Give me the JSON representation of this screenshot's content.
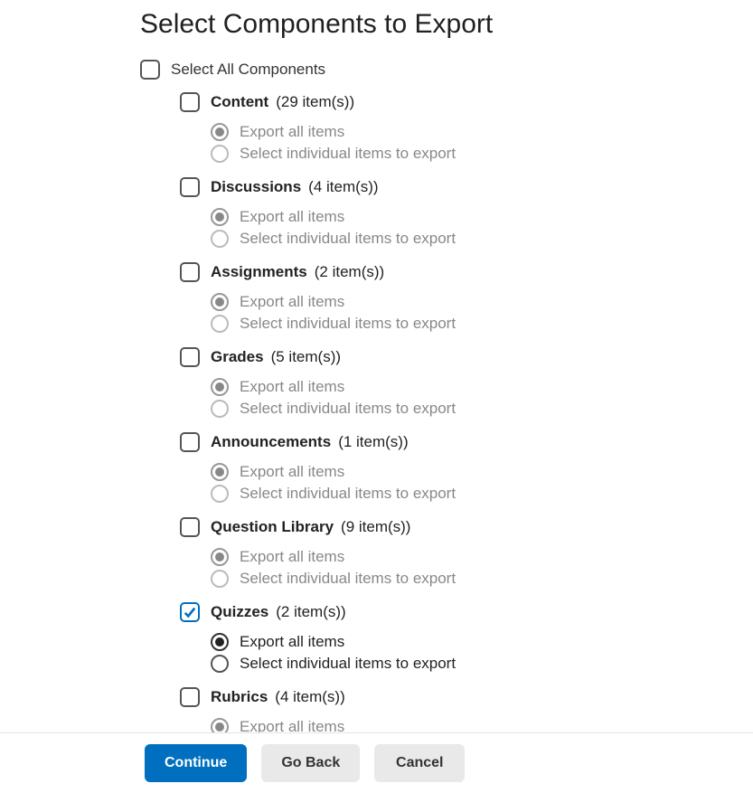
{
  "title": "Select Components to Export",
  "select_all_label": "Select All Components",
  "select_all_checked": false,
  "radio_option_all": "Export all items",
  "radio_option_individual": "Select individual items to export",
  "components": [
    {
      "key": "content",
      "name": "Content",
      "count_text": "(29 item(s))",
      "checked": false
    },
    {
      "key": "discussions",
      "name": "Discussions",
      "count_text": "(4 item(s))",
      "checked": false
    },
    {
      "key": "assignments",
      "name": "Assignments",
      "count_text": "(2 item(s))",
      "checked": false
    },
    {
      "key": "grades",
      "name": "Grades",
      "count_text": "(5 item(s))",
      "checked": false
    },
    {
      "key": "announcements",
      "name": "Announcements",
      "count_text": "(1 item(s))",
      "checked": false
    },
    {
      "key": "question-library",
      "name": "Question Library",
      "count_text": "(9 item(s))",
      "checked": false
    },
    {
      "key": "quizzes",
      "name": "Quizzes",
      "count_text": "(2 item(s))",
      "checked": true
    },
    {
      "key": "rubrics",
      "name": "Rubrics",
      "count_text": "(4 item(s))",
      "checked": false
    }
  ],
  "buttons": {
    "continue": "Continue",
    "go_back": "Go Back",
    "cancel": "Cancel"
  }
}
